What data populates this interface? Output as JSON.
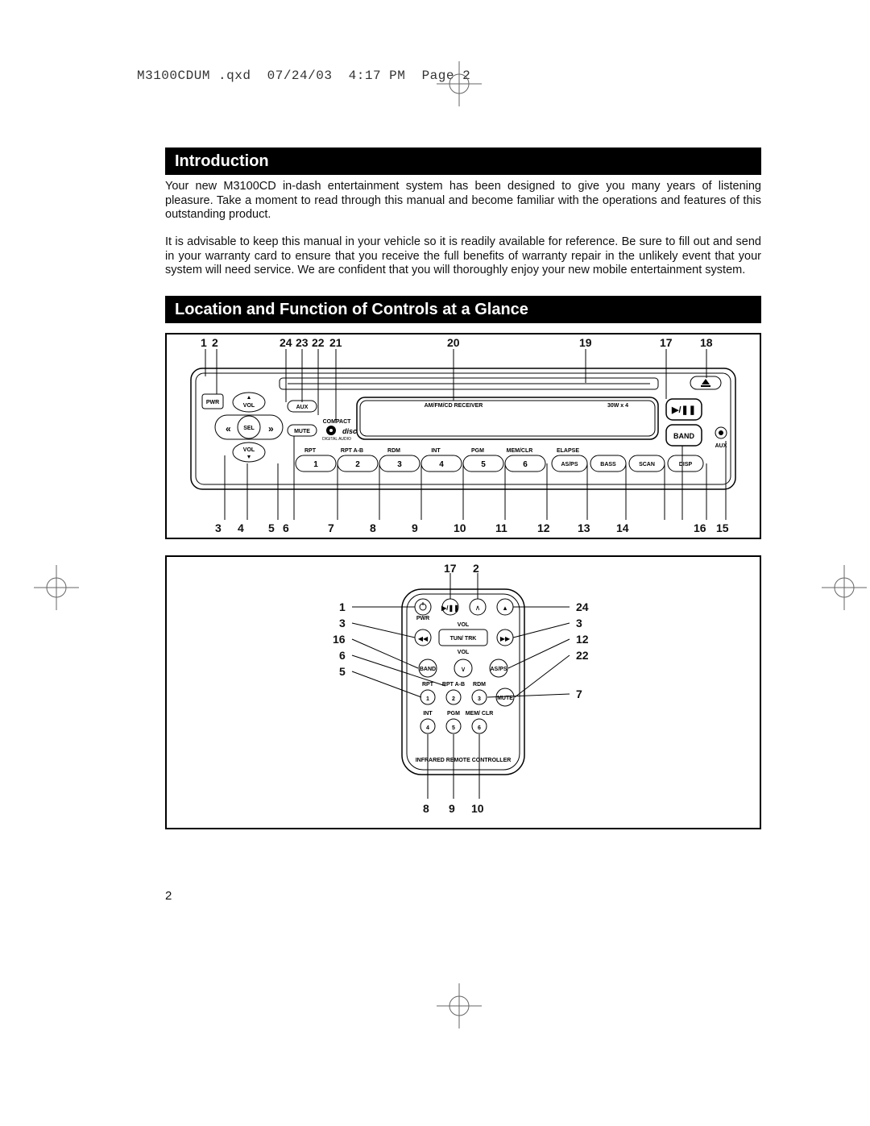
{
  "header": {
    "filename": "M3100CDUM .qxd",
    "date": "07/24/03",
    "time": "4:17 PM",
    "page_label": "Page",
    "page_num": "2"
  },
  "sections": {
    "intro_title": "Introduction",
    "intro_p1": "Your new M3100CD in-dash entertainment system has been designed to give you many years of listening pleasure. Take a moment to read through this manual and become familiar with the operations and features of this outstanding product.",
    "intro_p2": "It is advisable to keep this manual in your vehicle so it is readily available for reference. Be sure to fill out and send in your warranty card to ensure that you receive the full benefits of warranty repair in the unlikely event that your system will need service. We are confident that you will thoroughly enjoy your new mobile entertainment system.",
    "controls_title": "Location and Function of Controls at a Glance"
  },
  "head_unit": {
    "top_callouts": [
      "1",
      "2",
      "24",
      "23",
      "22",
      "21",
      "20",
      "19",
      "17",
      "18"
    ],
    "bottom_callouts": [
      "3",
      "4",
      "5",
      "6",
      "7",
      "8",
      "9",
      "10",
      "11",
      "12",
      "13",
      "14",
      "16",
      "15"
    ],
    "face": {
      "pwr": "PWR",
      "vol_up": "VOL",
      "vol_down": "VOL",
      "sel": "SEL",
      "aux_btn": "AUX",
      "mute_btn": "MUTE",
      "display_l": "AM/FM/CD RECEIVER",
      "display_r": "30W x 4",
      "play_pause": "▶/❚❚",
      "band": "BAND",
      "aux_jack": "AUX",
      "preset_top_labels": [
        "RPT",
        "RPT A-B",
        "RDM",
        "INT",
        "PGM",
        "MEM/CLR",
        "ELAPSE"
      ],
      "presets": [
        "1",
        "2",
        "3",
        "4",
        "5",
        "6"
      ],
      "right_btns": [
        "AS/PS",
        "BASS",
        "SCAN",
        "DISP"
      ],
      "cd_logo_top": "COMPACT",
      "cd_logo_mid": "disc",
      "cd_logo_btm": "DIGITAL AUDIO"
    }
  },
  "remote_unit": {
    "top_callouts": {
      "l": "17",
      "r": "2"
    },
    "left_side": [
      "1",
      "3",
      "16",
      "6",
      "5"
    ],
    "right_side": [
      "24",
      "3",
      "12",
      "22",
      "7"
    ],
    "bottom": [
      "8",
      "9",
      "10"
    ],
    "face": {
      "pwr": "PWR",
      "vol": "VOL",
      "tune": "TUN/ TRK",
      "band": "BAND",
      "asps": "AS/PS",
      "row_a": [
        "RPT",
        "RPT A-B",
        "RDM"
      ],
      "row_b": [
        "INT",
        "PGM",
        "MEM/ CLR"
      ],
      "mute": "MUTE",
      "caption": "INFRARED REMOTE CONTROLLER",
      "nums_a": [
        "1",
        "2",
        "3"
      ],
      "nums_b": [
        "4",
        "5",
        "6"
      ]
    }
  },
  "page_number": "2"
}
